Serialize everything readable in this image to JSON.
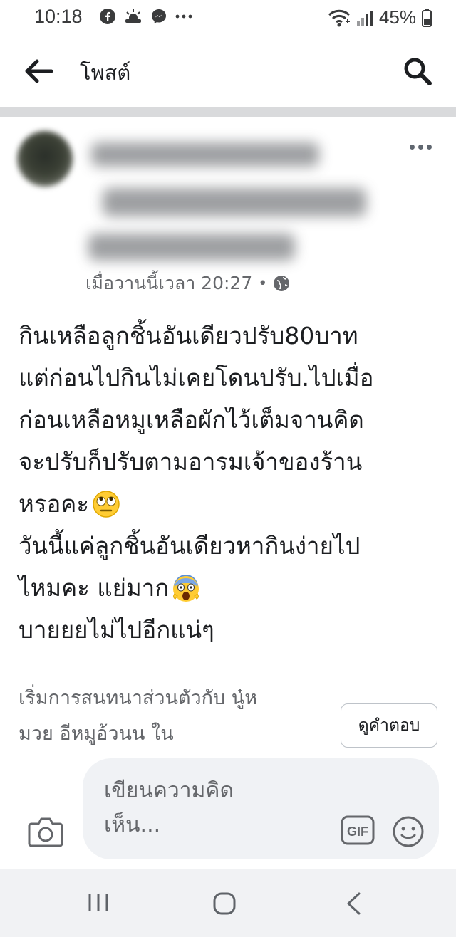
{
  "status_bar": {
    "time": "10:18",
    "battery": "45%",
    "left_icons": [
      "facebook-icon",
      "weather-icon",
      "messenger-icon",
      "more-dots-icon"
    ],
    "right_icons": [
      "wifi-icon",
      "signal-icon",
      "battery-icon"
    ]
  },
  "header": {
    "title": "โพสต์",
    "icons": [
      "back-arrow-icon",
      "search-icon"
    ]
  },
  "post": {
    "author_name": "",
    "timestamp": "เมื่อวานนี้เวลา 20:27",
    "separator": "•",
    "privacy_icon": "globe-icon",
    "body_lines": [
      "กินเหลือลูกชิ้นอันเดียวปรับ80บาท",
      "แต่ก่อนไปกินไม่เคยโดนปรับ.ไปเมื่อ",
      "ก่อนเหลือหมูเหลือผักไว้เต็มจานคิด",
      "จะปรับก็ปรับตามอารมเจ้าของร้าน",
      "หรอคะ",
      "วันนี้แค่ลูกชิ้นอันเดียวหากินง่ายไป",
      "ไหมคะ แย่มาก",
      "บายยยไม่ไปอีกแน่ๆ"
    ],
    "emojis": [
      "eye-roll-emoji",
      "screaming-face-emoji"
    ],
    "private_chat_lines": [
      "เริ่มการสนทนาส่วนตัวกับ นู๋ห",
      "มวย อีหมูอ้วนน ใน"
    ],
    "reply_button": "ดูคำตอบ"
  },
  "composer": {
    "placeholder_lines": [
      "เขียนความคิด",
      "เห็น..."
    ],
    "icons": [
      "camera-icon",
      "gif-icon",
      "emoji-icon"
    ]
  },
  "nav_bar": {
    "icons": [
      "recent-apps-icon",
      "home-icon",
      "back-icon"
    ]
  },
  "colors": {
    "text_primary": "#1c1e21",
    "text_secondary": "#65676b",
    "divider": "#d9dadc",
    "composer_bg": "#f0f2f5"
  }
}
